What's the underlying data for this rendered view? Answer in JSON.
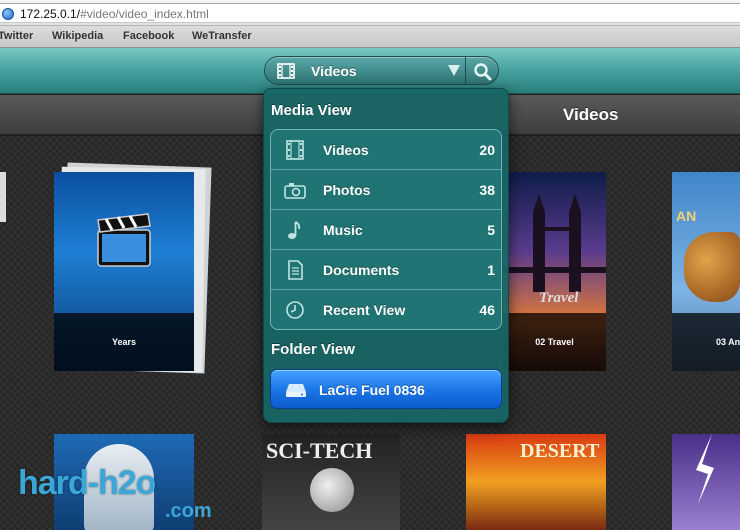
{
  "browser": {
    "url_host": "172.25.0.1/",
    "url_path": "#video/video_index.html",
    "bookmarks": [
      "Twitter",
      "Wikipedia",
      "Facebook",
      "WeTransfer"
    ]
  },
  "toolbar": {
    "view_select_label": "Videos",
    "search_icon": "search-icon"
  },
  "header": {
    "title": "Videos"
  },
  "dropdown": {
    "media_view_title": "Media View",
    "items": [
      {
        "icon": "film-icon",
        "label": "Videos",
        "count": "20"
      },
      {
        "icon": "camera-icon",
        "label": "Photos",
        "count": "38"
      },
      {
        "icon": "music-note-icon",
        "label": "Music",
        "count": "5"
      },
      {
        "icon": "document-icon",
        "label": "Documents",
        "count": "1"
      },
      {
        "icon": "clock-icon",
        "label": "Recent View",
        "count": "46"
      }
    ],
    "folder_view_title": "Folder View",
    "folder": {
      "icon": "drive-icon",
      "label": "LaCie Fuel 0836"
    }
  },
  "grid": {
    "tiles": [
      {
        "caption": "Years"
      },
      {
        "caption": "02 Travel",
        "art_text": "Travel"
      },
      {
        "caption": "03 An",
        "art_text": "AN"
      },
      {
        "art_text": "SCI-TECH"
      },
      {
        "art_text": "DESERT"
      }
    ]
  },
  "watermark": {
    "main": "hard-h2o",
    "sub": ".com"
  },
  "colors": {
    "teal": "#2a7f7d",
    "panel": "#186666",
    "folder_blue": "#1a73e6"
  }
}
